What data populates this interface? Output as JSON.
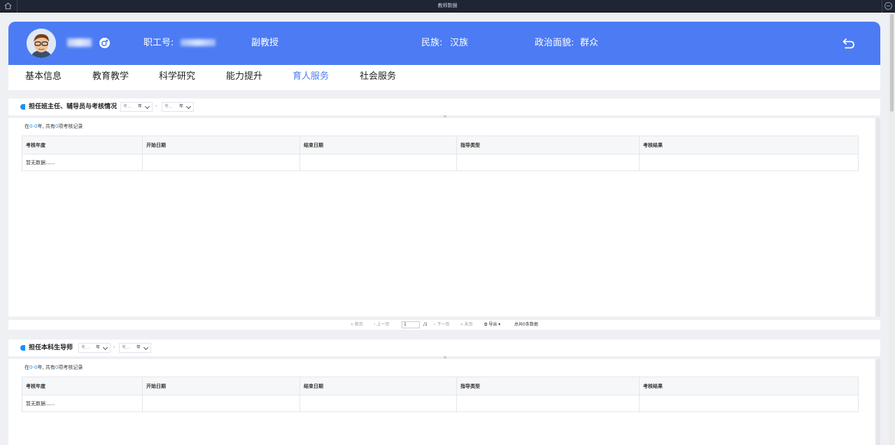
{
  "window": {
    "title": "教师数据"
  },
  "header": {
    "staff_id_label": "职工号:",
    "title": "副教授",
    "ethnicity_label": "民族:",
    "ethnicity": "汉族",
    "political_label": "政治面貌:",
    "political": "群众",
    "back_icon": "undo-icon",
    "gender_icon": "male-icon"
  },
  "tabs": [
    {
      "label": "基本信息"
    },
    {
      "label": "教育教学"
    },
    {
      "label": "科学研究"
    },
    {
      "label": "能力提升"
    },
    {
      "label": "育人服务",
      "active": true
    },
    {
      "label": "社会服务"
    }
  ],
  "colors": {
    "accent": "#4c7bf3",
    "link": "#1890ff"
  },
  "sections": [
    {
      "title": "担任班主任、辅导员与考核情况",
      "from_placeholder": "考...",
      "year_suffix": "年",
      "range_sep": "-",
      "to_placeholder": "考...",
      "count_prefix": "在",
      "count_range": "0-0",
      "count_mid": "年, 共有",
      "count_num": "0",
      "count_suffix": "项考核记录",
      "columns": [
        "考核年度",
        "开始日期",
        "结束日期",
        "指导类型",
        "考核结果"
      ],
      "empty_text": "暂无数据......"
    },
    {
      "title": "担任本科生导师",
      "from_placeholder": "考...",
      "year_suffix": "年",
      "range_sep": "-",
      "to_placeholder": "考...",
      "count_prefix": "在",
      "count_range": "0-0",
      "count_mid": "年, 共有",
      "count_num": "0",
      "count_suffix": "项考核记录",
      "columns": [
        "考核年度",
        "开始日期",
        "结束日期",
        "指导类型",
        "考核结果"
      ],
      "empty_text": "暂无数据......"
    }
  ],
  "pager": {
    "first": "首页",
    "prev": "上一页",
    "page_value": "1",
    "total_pages": "/1",
    "next": "下一页",
    "last": "末页",
    "export": "导出",
    "total": "总共0条数据"
  }
}
